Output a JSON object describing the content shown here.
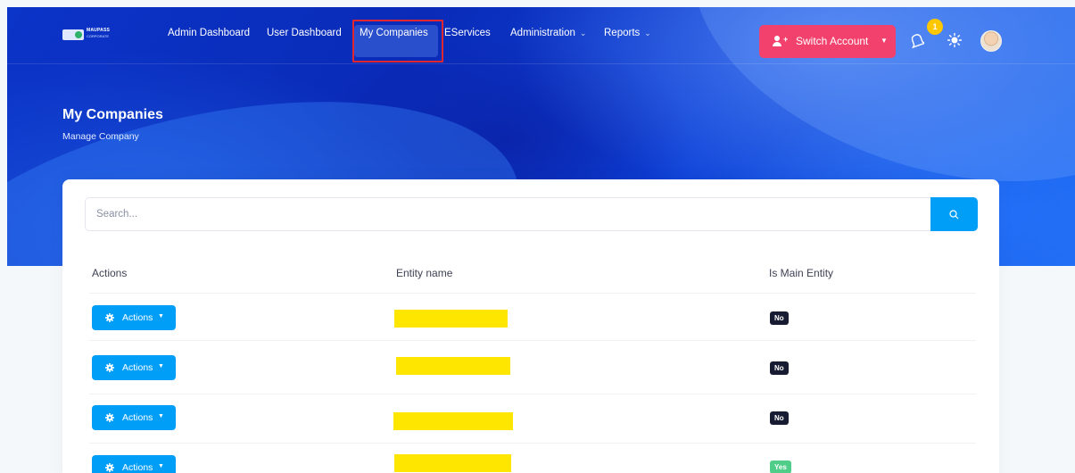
{
  "brand": {
    "name": "MAUPASS",
    "tagline": "CORPORATE"
  },
  "nav": {
    "items": [
      {
        "label": "Admin Dashboard",
        "dropdown": false
      },
      {
        "label": "User Dashboard",
        "dropdown": false
      },
      {
        "label": "My Companies",
        "dropdown": false,
        "active": true
      },
      {
        "label": "EServices",
        "dropdown": false
      },
      {
        "label": "Administration",
        "dropdown": true
      },
      {
        "label": "Reports",
        "dropdown": true
      }
    ],
    "chevron": "⌄"
  },
  "header_actions": {
    "switch_account_label": "Switch Account",
    "notification_count": "1",
    "icons": [
      "user-plus-icon",
      "bell-icon",
      "sun-icon",
      "avatar"
    ]
  },
  "page": {
    "title": "My Companies",
    "subtitle": "Manage Company"
  },
  "search": {
    "placeholder": "Search...",
    "value": ""
  },
  "table": {
    "columns": [
      "Actions",
      "Entity name",
      "Is Main Entity"
    ],
    "rows": [
      {
        "action_label": "Actions",
        "entity_name": "[redacted]",
        "is_main": "No"
      },
      {
        "action_label": "Actions",
        "entity_name": "[redacted]",
        "is_main": "No"
      },
      {
        "action_label": "Actions",
        "entity_name": "[redacted]",
        "is_main": "No"
      },
      {
        "action_label": "Actions",
        "entity_name": "[redacted]",
        "is_main": "Yes"
      }
    ]
  },
  "colors": {
    "accent": "#009ef7",
    "danger": "#f1416c",
    "warning": "#ffc700",
    "success": "#50cd89",
    "dark": "#181c32",
    "redaction": "#ffe600",
    "annotation": "#e0262f"
  }
}
